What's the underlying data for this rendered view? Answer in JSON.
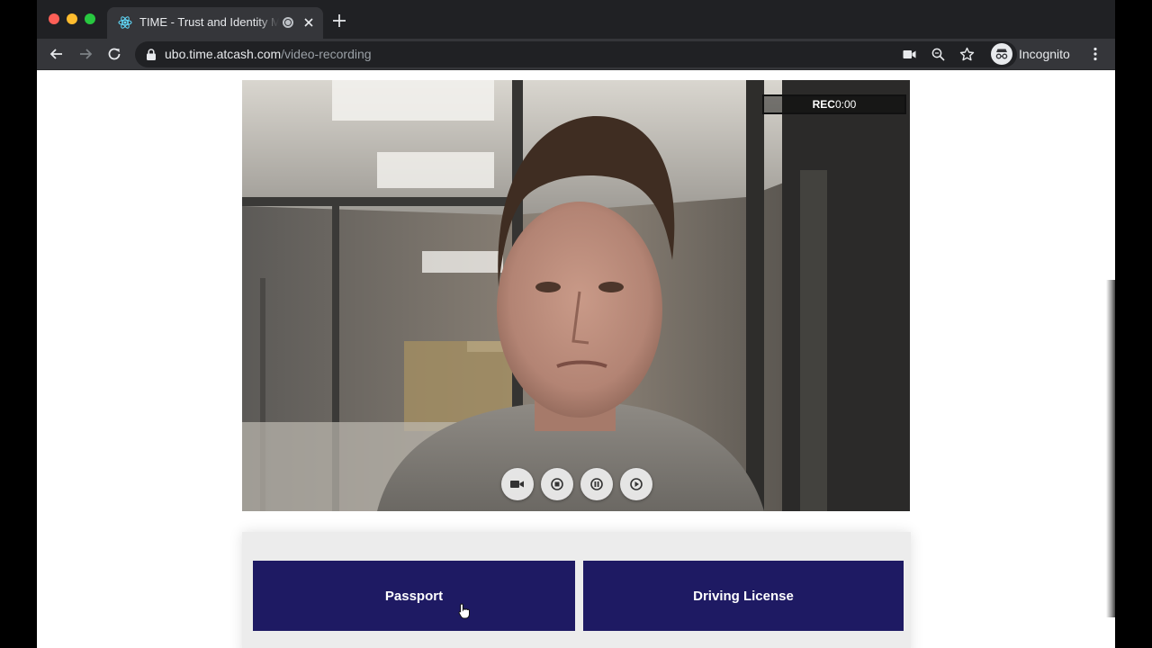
{
  "browser": {
    "tab": {
      "title": "TIME - Trust and Identity Management",
      "favicon": "react-icon",
      "status_icon": "recording-indicator-icon",
      "close_icon": "close-icon"
    },
    "new_tab_icon": "plus-icon",
    "toolbar": {
      "back_icon": "arrow-left-icon",
      "forward_icon": "arrow-right-icon",
      "reload_icon": "reload-icon",
      "lock_icon": "lock-icon",
      "url_host": "ubo.time.atcash.com",
      "url_path": "/video-recording",
      "camera_icon": "camera-in-use-icon",
      "zoom_icon": "magnifier-icon",
      "bookmark_icon": "star-icon",
      "profile_label": "Incognito",
      "menu_icon": "kebab-menu-icon"
    }
  },
  "recorder": {
    "rec_label": "REC",
    "elapsed": "0:00",
    "controls": [
      "video-camera-icon",
      "stop-icon",
      "pause-icon",
      "play-icon"
    ]
  },
  "document_options": {
    "passport_label": "Passport",
    "driving_license_label": "Driving License"
  },
  "colors": {
    "tabstrip": "#202124",
    "toolbar": "#35363a",
    "document_button": "#1e1a63",
    "rec_background": "#000000"
  }
}
